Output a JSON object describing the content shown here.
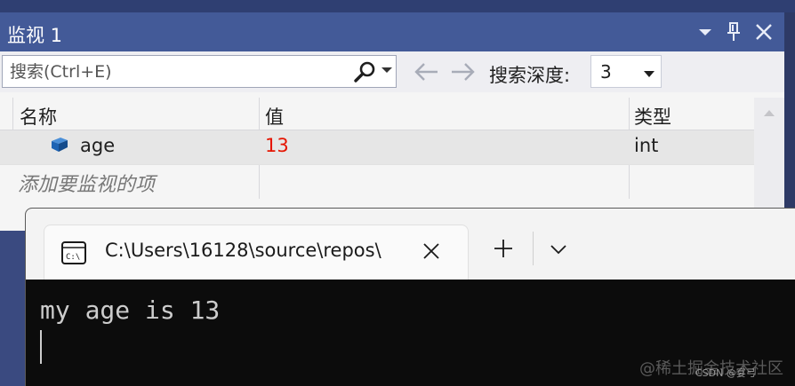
{
  "watch": {
    "title": "监视 1",
    "search": {
      "placeholder": "搜索(Ctrl+E)"
    },
    "depth_label": "搜索深度:",
    "depth_value": "3",
    "columns": [
      "名称",
      "值",
      "类型"
    ],
    "rows": [
      {
        "name": "age",
        "value": "13",
        "type": "int"
      }
    ],
    "add_hint": "添加要监视的项",
    "colors": {
      "titlebar": "#435a98",
      "value_changed": "#e51400",
      "icon_blue": "#1e64b4"
    }
  },
  "terminal": {
    "tab_title": "C:\\Users\\16128\\source\\repos\\",
    "output": "my age is 13",
    "watermark": "@稀土掘金技术社区"
  },
  "credit": "CSDN @宴弓"
}
